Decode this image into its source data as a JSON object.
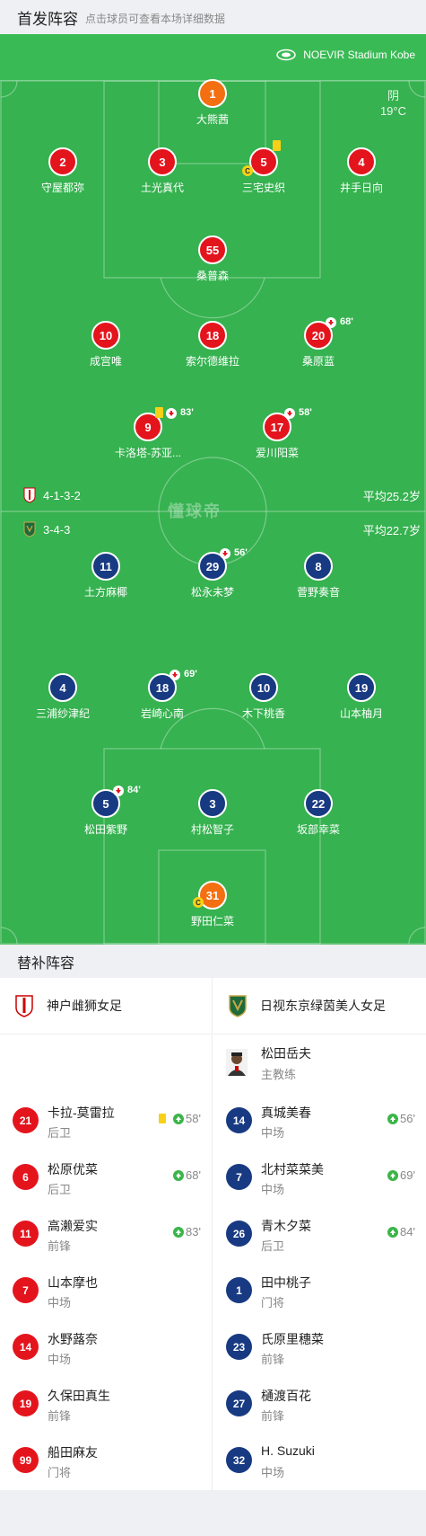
{
  "header": {
    "title": "首发阵容",
    "subtitle": "点击球员可查看本场详细数据"
  },
  "venue": {
    "name": "NOEVIR Stadium Kobe",
    "icon": "stadium-icon"
  },
  "weather": {
    "condition": "阴",
    "temperature": "19°C"
  },
  "watermark": "懂球帝",
  "home": {
    "name": "神户雌狮女足",
    "formation": "4-1-3-2",
    "avg_age": "平均25.2岁",
    "colors": {
      "kit": "#e4141d",
      "goalkeeper": "#f36f11"
    },
    "lineup": [
      {
        "num": "1",
        "name": "大熊茜"
      },
      {
        "num": "2",
        "name": "守屋都弥"
      },
      {
        "num": "3",
        "name": "土光真代"
      },
      {
        "num": "5",
        "name": "三宅史织",
        "captain": "C"
      },
      {
        "num": "4",
        "name": "井手日向"
      },
      {
        "num": "55",
        "name": "桑普森"
      },
      {
        "num": "10",
        "name": "成宫唯"
      },
      {
        "num": "18",
        "name": "索尔德维拉"
      },
      {
        "num": "20",
        "name": "桑原蓝",
        "sub_out": "68'"
      },
      {
        "num": "9",
        "name": "卡洛塔-苏亚...",
        "sub_out": "83'"
      },
      {
        "num": "17",
        "name": "爱川阳菜",
        "sub_out": "58'"
      }
    ],
    "subs": [
      {
        "num": "21",
        "name": "卡拉-莫雷拉",
        "pos": "后卫",
        "sub_in": "58'"
      },
      {
        "num": "6",
        "name": "松原优菜",
        "pos": "后卫",
        "sub_in": "68'"
      },
      {
        "num": "11",
        "name": "高濑爱实",
        "pos": "前锋",
        "sub_in": "83'"
      },
      {
        "num": "7",
        "name": "山本摩也",
        "pos": "中场"
      },
      {
        "num": "14",
        "name": "水野蕗奈",
        "pos": "中场"
      },
      {
        "num": "19",
        "name": "久保田真生",
        "pos": "前锋"
      },
      {
        "num": "99",
        "name": "船田麻友",
        "pos": "门将"
      }
    ]
  },
  "away": {
    "name": "日视东京绿茵美人女足",
    "formation": "3-4-3",
    "avg_age": "平均22.7岁",
    "colors": {
      "kit": "#183a82",
      "goalkeeper": "#f36f11"
    },
    "lineup": [
      {
        "num": "11",
        "name": "土方麻椰"
      },
      {
        "num": "29",
        "name": "松永未梦",
        "sub_out": "56'"
      },
      {
        "num": "8",
        "name": "菅野奏音"
      },
      {
        "num": "4",
        "name": "三浦纱津纪"
      },
      {
        "num": "18",
        "name": "岩崎心南",
        "sub_out": "69'"
      },
      {
        "num": "10",
        "name": "木下桃香"
      },
      {
        "num": "19",
        "name": "山本柚月"
      },
      {
        "num": "5",
        "name": "松田紫野",
        "sub_out": "84'"
      },
      {
        "num": "3",
        "name": "村松智子"
      },
      {
        "num": "22",
        "name": "坂部幸菜"
      },
      {
        "num": "31",
        "name": "野田仁菜",
        "captain": "C"
      }
    ],
    "coach": {
      "name": "松田岳夫",
      "role": "主教练"
    },
    "subs": [
      {
        "num": "14",
        "name": "真城美春",
        "pos": "中场",
        "sub_in": "56'"
      },
      {
        "num": "7",
        "name": "北村菜菜美",
        "pos": "中场",
        "sub_in": "69'"
      },
      {
        "num": "26",
        "name": "青木夕菜",
        "pos": "后卫",
        "sub_in": "84'"
      },
      {
        "num": "1",
        "name": "田中桃子",
        "pos": "门将"
      },
      {
        "num": "23",
        "name": "氏原里穗菜",
        "pos": "前锋"
      },
      {
        "num": "27",
        "name": "樋渡百花",
        "pos": "前锋"
      },
      {
        "num": "32",
        "name": "H. Suzuki",
        "pos": "中场"
      }
    ]
  },
  "subs_section": {
    "title": "替补阵容"
  }
}
